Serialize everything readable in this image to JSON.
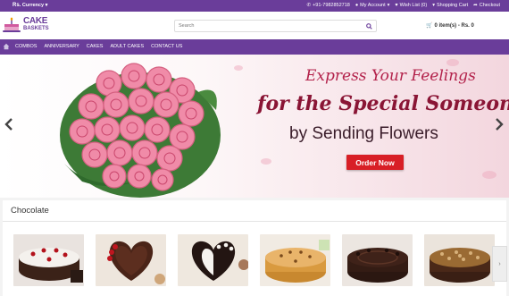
{
  "topbar": {
    "currency_symbol": "Rs.",
    "currency_label": "Currency",
    "phone": "+91-7982852718",
    "my_account": "My Account",
    "wishlist": "Wish List (0)",
    "shopping_cart": "Shopping Cart",
    "checkout": "Checkout"
  },
  "header": {
    "logo_line1": "CAKE",
    "logo_line2": "BASKETS",
    "search_placeholder": "Search",
    "cart_summary": "0 item(s) - Rs. 0"
  },
  "nav": {
    "items": [
      "COMBOS",
      "ANNIVERSARY",
      "CAKES",
      "ADULT CAKES",
      "CONTACT US"
    ]
  },
  "banner": {
    "line1": "Express Your Feelings",
    "line2": "for the Special Someone",
    "line3": "by Sending Flowers",
    "cta": "Order Now"
  },
  "section": {
    "title": "Chocolate"
  },
  "colors": {
    "brand_purple": "#6a3d9a",
    "cta_red": "#d81f26"
  }
}
